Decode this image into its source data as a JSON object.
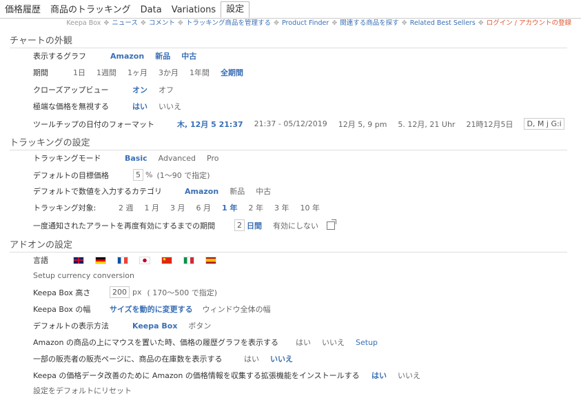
{
  "tabs": [
    "価格履歴",
    "商品のトラッキング",
    "Data",
    "Variations",
    "設定"
  ],
  "nav": {
    "keepa_box": "Keepa Box",
    "links": [
      "ニュース",
      "コメント",
      "トラッキング商品を管理する",
      "Product Finder",
      "関連する商品を探す",
      "Related Best Sellers"
    ],
    "login": "ログイン / アカウントの登録"
  },
  "sections": {
    "chart": "チャートの外観",
    "tracking": "トラッキングの設定",
    "addon": "アドオンの設定"
  },
  "chart": {
    "graph_label": "表示するグラフ",
    "graph_options": [
      "Amazon",
      "新品",
      "中古"
    ],
    "period_label": "期間",
    "period_options": [
      "1日",
      "1週間",
      "1ヶ月",
      "3か月",
      "1年間",
      "全期間"
    ],
    "closeup_label": "クローズアップビュー",
    "closeup_on": "オン",
    "closeup_off": "オフ",
    "extreme_label": "極端な価格を無視する",
    "extreme_yes": "はい",
    "extreme_no": "いいえ",
    "tooltip_label": "ツールチップの日付のフォーマット",
    "tooltip_options": [
      "木, 12月 5 21:37",
      "21:37 - 05/12/2019",
      "12月 5, 9 pm",
      "5. 12月, 21 Uhr",
      "21時12月5日"
    ],
    "tooltip_custom": "D, M j G:i"
  },
  "tracking": {
    "mode_label": "トラッキングモード",
    "mode_options": [
      "Basic",
      "Advanced",
      "Pro"
    ],
    "target_label": "デフォルトの目標価格",
    "target_value": "5",
    "target_unit": "%",
    "target_hint": "(1〜90 で指定)",
    "category_label": "デフォルトで数値を入力するカテゴリ",
    "category_options": [
      "Amazon",
      "新品",
      "中古"
    ],
    "duration_label": "トラッキング対象:",
    "duration_options": [
      "2 週",
      "1 月",
      "3 月",
      "6 月",
      "1 年",
      "2 年",
      "3 年",
      "10 年"
    ],
    "realert_label": "一度通知されたアラートを再度有効にするまでの期間",
    "realert_value": "2",
    "realert_unit": "日間",
    "realert_never": "有効にしない"
  },
  "addon": {
    "lang_label": "言語",
    "flags": [
      "gb-flag-icon",
      "de-flag-icon",
      "fr-flag-icon",
      "jp-flag-icon",
      "cn-flag-icon",
      "it-flag-icon",
      "es-flag-icon"
    ],
    "currency_link": "Setup currency conversion",
    "height_label": "Keepa Box 高さ",
    "height_value": "200",
    "height_unit": "px",
    "height_hint": "( 170〜500 で指定)",
    "width_label": "Keepa Box の幅",
    "width_options": [
      "サイズを動的に変更する",
      "ウィンドウ全体の幅"
    ],
    "display_label": "デフォルトの表示方法",
    "display_options": [
      "Keepa Box",
      "ボタン"
    ],
    "hover_label": "Amazon の商品の上にマウスを置いた時、価格の履歴グラフを表示する",
    "hover_yes": "はい",
    "hover_no": "いいえ",
    "hover_setup": "Setup",
    "stock_label": "一部の販売者の販売ページに、商品の在庫数を表示する",
    "stock_yes": "はい",
    "stock_no": "いいえ",
    "collect_label": "Keepa の価格データ改善のために Amazon の価格情報を収集する拡張機能をインストールする",
    "collect_yes": "はい",
    "collect_no": "いいえ",
    "reset_label": "設定をデフォルトにリセット"
  }
}
